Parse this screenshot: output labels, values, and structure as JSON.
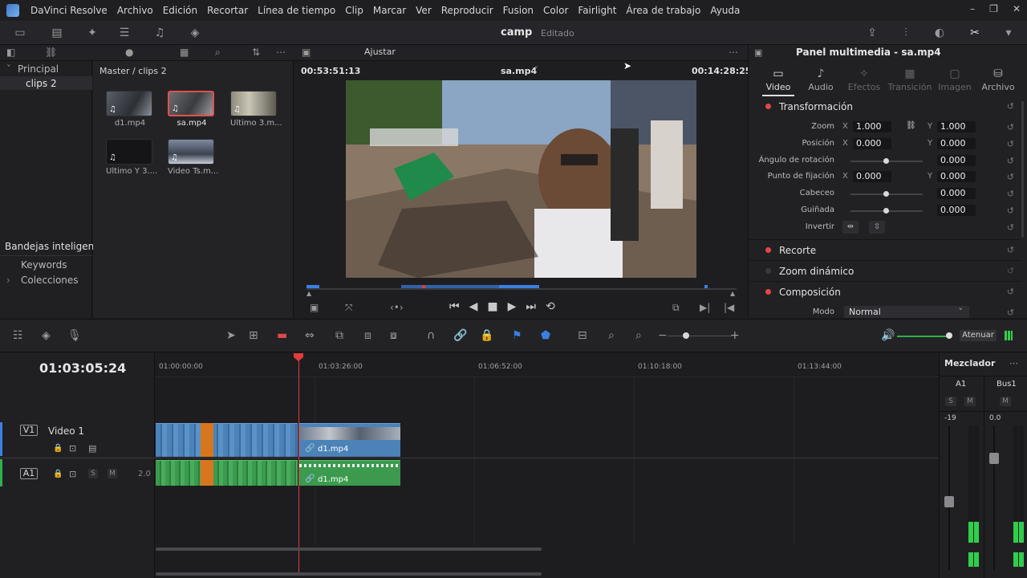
{
  "menu": {
    "app_name": "DaVinci Resolve",
    "items": [
      "Archivo",
      "Edición",
      "Recortar",
      "Línea de tiempo",
      "Clip",
      "Marcar",
      "Ver",
      "Reproducir",
      "Fusion",
      "Color",
      "Fairlight",
      "Área de trabajo",
      "Ayuda"
    ]
  },
  "project": {
    "title": "camp",
    "status": "Editado"
  },
  "media_pool": {
    "zoom_label": "Ajustar",
    "tree": {
      "root": "Principal",
      "child": "clips 2"
    },
    "smart_bins": {
      "title": "Bandejas inteligentes",
      "items": [
        "Keywords",
        "Colecciones"
      ]
    },
    "path": "Master / clips 2",
    "clips": [
      {
        "name": "d1.mp4",
        "selected": false
      },
      {
        "name": "sa.mp4",
        "selected": true
      },
      {
        "name": "Ultimo 3.m...",
        "selected": false
      },
      {
        "name": "Ultimo Y 3....",
        "selected": false
      },
      {
        "name": "Video Ts.m...",
        "selected": false
      }
    ]
  },
  "viewer": {
    "timecode_left": "00:53:51:13",
    "clip_name": "sa.mp4",
    "timecode_right": "00:14:28:25"
  },
  "inspector": {
    "title": "Panel multimedia - sa.mp4",
    "tabs": [
      {
        "label": "Video",
        "icon": "monitor-icon",
        "active": true
      },
      {
        "label": "Audio",
        "icon": "note-icon",
        "active": false
      },
      {
        "label": "Efectos",
        "icon": "effects-icon",
        "active": false
      },
      {
        "label": "Transición",
        "icon": "transition-icon",
        "active": false
      },
      {
        "label": "Imagen",
        "icon": "image-icon",
        "active": false
      },
      {
        "label": "Archivo",
        "icon": "file-icon",
        "active": false
      }
    ],
    "transform": {
      "title": "Transformación",
      "zoom": {
        "label": "Zoom",
        "x": "1.000",
        "y": "1.000"
      },
      "position": {
        "label": "Posición",
        "x": "0.000",
        "y": "0.000"
      },
      "rotation": {
        "label": "Ángulo de rotación",
        "value": "0.000"
      },
      "anchor": {
        "label": "Punto de fijación",
        "x": "0.000",
        "y": "0.000"
      },
      "pitch": {
        "label": "Cabeceo",
        "value": "0.000"
      },
      "yaw": {
        "label": "Guiñada",
        "value": "0.000"
      },
      "flip": {
        "label": "Invertir"
      }
    },
    "crop": {
      "title": "Recorte"
    },
    "dynamic_zoom": {
      "title": "Zoom dinámico"
    },
    "composite": {
      "title": "Composición",
      "mode_label": "Modo",
      "mode_value": "Normal"
    },
    "axis_x": "X",
    "axis_y": "Y"
  },
  "timeline": {
    "timecode": "01:03:05:24",
    "ruler_ticks": [
      "01:00:00:00",
      "01:03:26:00",
      "01:06:52:00",
      "01:10:18:00",
      "01:13:44:00"
    ],
    "tracks": {
      "video": {
        "id": "V1",
        "name": "Video 1",
        "clip": "d1.mp4"
      },
      "audio": {
        "id": "A1",
        "channels": "2.0",
        "clip": "d1.mp4",
        "solo": "S",
        "mute": "M"
      }
    },
    "dim_label": "Atenuar"
  },
  "mixer": {
    "title": "Mezclador",
    "channels": [
      {
        "name": "A1",
        "level_db": "-19",
        "solo": "S",
        "mute": "M"
      },
      {
        "name": "Bus1",
        "level_db": "0.0",
        "mute": "M"
      }
    ]
  },
  "colors": {
    "accent_red": "#e24848",
    "video_clip": "#4b82b8",
    "audio_clip": "#3b9a4e",
    "meter_green": "#2fcf4c"
  }
}
